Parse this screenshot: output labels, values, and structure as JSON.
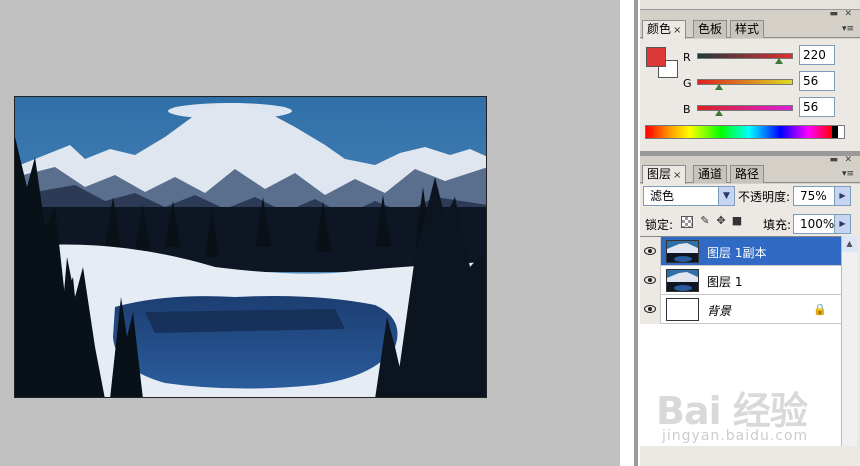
{
  "color_panel": {
    "tabs": [
      {
        "label": "颜色",
        "active": true
      },
      {
        "label": "色板",
        "active": false
      },
      {
        "label": "样式",
        "active": false
      }
    ],
    "close_glyph": "×",
    "foreground_color": "#dc3838",
    "background_color": "#ffffff",
    "channels": [
      {
        "label": "R",
        "value": "220",
        "fraction": 0.863
      },
      {
        "label": "G",
        "value": "56",
        "fraction": 0.22
      },
      {
        "label": "B",
        "value": "56",
        "fraction": 0.22
      }
    ]
  },
  "layers_panel": {
    "tabs": [
      {
        "label": "图层",
        "active": true
      },
      {
        "label": "通道",
        "active": false
      },
      {
        "label": "路径",
        "active": false
      }
    ],
    "close_glyph": "×",
    "blend_mode": "滤色",
    "opacity_label": "不透明度:",
    "opacity_value": "75%",
    "lock_label": "锁定:",
    "fill_label": "填充:",
    "fill_value": "100%",
    "layers": [
      {
        "name": "图层 1副本",
        "selected": true,
        "visible": true,
        "thumbnail": "photo"
      },
      {
        "name": "图层 1",
        "selected": false,
        "visible": true,
        "thumbnail": "photo"
      },
      {
        "name": "背景",
        "selected": false,
        "visible": true,
        "thumbnail": "white",
        "locked": true
      }
    ]
  },
  "icons": {
    "lock_transparent": "checkerboard-icon",
    "lock_paint": "brush-icon",
    "lock_move": "move-icon",
    "lock_all": "lock-icon",
    "visibility": "eye-icon",
    "panel_menu": "triangle-menu-icon"
  },
  "watermark": {
    "logo_text": "Bai 经验",
    "url": "jingyan.baidu.com"
  }
}
